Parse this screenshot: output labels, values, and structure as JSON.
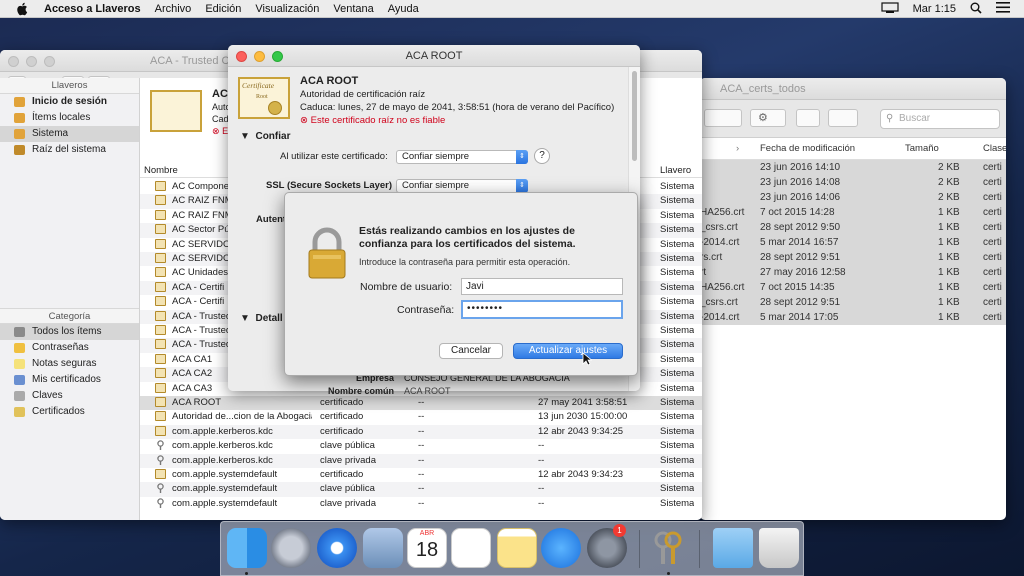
{
  "menubar": {
    "app": "Acceso a Llaveros",
    "items": [
      "Archivo",
      "Edición",
      "Visualización",
      "Ventana",
      "Ayuda"
    ],
    "clock": "Mar 1:15"
  },
  "finder": {
    "title": "ACA_certs_todos",
    "search_placeholder": "Buscar",
    "headers": {
      "date": "Fecha de modificación",
      "size": "Tamaño",
      "kind": "Clase"
    },
    "rows": [
      {
        "name": "",
        "date": "23 jun 2016 14:10",
        "size": "2 KB",
        "kind": "certi"
      },
      {
        "name": "",
        "date": "23 jun 2016 14:08",
        "size": "2 KB",
        "kind": "certi"
      },
      {
        "name": "",
        "date": "23 jun 2016 14:06",
        "size": "2 KB",
        "kind": "certi"
      },
      {
        "name": "HA256.crt",
        "date": "7 oct 2015 14:28",
        "size": "1 KB",
        "kind": "certi"
      },
      {
        "name": "_csrs.crt",
        "date": "28 sept 2012 9:50",
        "size": "1 KB",
        "kind": "certi"
      },
      {
        "name": "-2014.crt",
        "date": "5 mar 2014 16:57",
        "size": "1 KB",
        "kind": "certi"
      },
      {
        "name": "rs.crt",
        "date": "28 sept 2012 9:51",
        "size": "1 KB",
        "kind": "certi"
      },
      {
        "name": "rt",
        "date": "27 may 2016 12:58",
        "size": "1 KB",
        "kind": "certi"
      },
      {
        "name": "HA256.crt",
        "date": "7 oct 2015 14:35",
        "size": "1 KB",
        "kind": "certi"
      },
      {
        "name": "_csrs.crt",
        "date": "28 sept 2012 9:51",
        "size": "1 KB",
        "kind": "certi"
      },
      {
        "name": "-2014.crt",
        "date": "5 mar 2014 17:05",
        "size": "1 KB",
        "kind": "certi"
      }
    ]
  },
  "keychain": {
    "bg_title": "ACA - Trusted Certificates - 2014",
    "sidebar": {
      "keychains_header": "Llaveros",
      "keychains": [
        "Inicio de sesión",
        "Ítems locales",
        "Sistema",
        "Raíz del sistema"
      ],
      "category_header": "Categoría",
      "categories": [
        "Todos los ítems",
        "Contraseñas",
        "Notas seguras",
        "Mis certificados",
        "Claves",
        "Certificados"
      ]
    },
    "preview": {
      "name": "ACA",
      "line1": "Autor",
      "line2": "Caduc",
      "warn": "E"
    },
    "headers": {
      "name": "Nombre",
      "keychain": "Llavero"
    },
    "rows": [
      {
        "name": "AC Componen",
        "kind": "",
        "date": "",
        "exp": "",
        "kc": "Sistema"
      },
      {
        "name": "AC RAIZ FNM",
        "kind": "",
        "date": "",
        "exp": "",
        "kc": "Sistema"
      },
      {
        "name": "AC RAIZ FNM",
        "kind": "",
        "date": "",
        "exp": "",
        "kc": "Sistema"
      },
      {
        "name": "AC Sector Pú",
        "kind": "",
        "date": "",
        "exp": "",
        "kc": "Sistema"
      },
      {
        "name": "AC SERVIDOR",
        "kind": "",
        "date": "",
        "exp": "",
        "kc": "Sistema"
      },
      {
        "name": "AC SERVIDOR",
        "kind": "",
        "date": "",
        "exp": "",
        "kc": "Sistema"
      },
      {
        "name": "AC Unidades.",
        "kind": "",
        "date": "",
        "exp": "",
        "kc": "Sistema"
      },
      {
        "name": "ACA - Certifi",
        "kind": "",
        "date": "",
        "exp": "",
        "kc": "Sistema"
      },
      {
        "name": "ACA - Certifi",
        "kind": "",
        "date": "",
        "exp": "",
        "kc": "Sistema"
      },
      {
        "name": "ACA - Trusted",
        "kind": "",
        "date": "",
        "exp": "",
        "kc": "Sistema"
      },
      {
        "name": "ACA - Trusted",
        "kind": "",
        "date": "",
        "exp": "",
        "kc": "Sistema"
      },
      {
        "name": "ACA - Trusted",
        "kind": "",
        "date": "",
        "exp": "",
        "kc": "Sistema"
      },
      {
        "name": "ACA CA1",
        "kind": "",
        "date": "",
        "exp": "",
        "kc": "Sistema"
      },
      {
        "name": "ACA CA2",
        "kind": "",
        "date": "",
        "exp": "",
        "kc": "Sistema"
      },
      {
        "name": "ACA CA3",
        "kind": "",
        "date": "",
        "exp": "",
        "kc": "Sistema"
      },
      {
        "name": "ACA ROOT",
        "kind": "certificado",
        "date": "--",
        "exp": "27 may 2041 3:58:51",
        "kc": "Sistema"
      },
      {
        "name": "Autoridad de...cion de la Abogacia",
        "kind": "certificado",
        "date": "--",
        "exp": "13 jun 2030 15:00:00",
        "kc": "Sistema"
      },
      {
        "name": "com.apple.kerberos.kdc",
        "kind": "certificado",
        "date": "--",
        "exp": "12 abr 2043 9:34:25",
        "kc": "Sistema"
      },
      {
        "name": "com.apple.kerberos.kdc",
        "kind": "clave pública",
        "date": "--",
        "exp": "--",
        "kc": "Sistema"
      },
      {
        "name": "com.apple.kerberos.kdc",
        "kind": "clave privada",
        "date": "--",
        "exp": "--",
        "kc": "Sistema"
      },
      {
        "name": "com.apple.systemdefault",
        "kind": "certificado",
        "date": "--",
        "exp": "12 abr 2043 9:34:23",
        "kc": "Sistema"
      },
      {
        "name": "com.apple.systemdefault",
        "kind": "clave pública",
        "date": "--",
        "exp": "--",
        "kc": "Sistema"
      },
      {
        "name": "com.apple.systemdefault",
        "kind": "clave privada",
        "date": "--",
        "exp": "--",
        "kc": "Sistema"
      }
    ]
  },
  "acaroot": {
    "title": "ACA ROOT",
    "cert_name": "ACA ROOT",
    "subtitle": "Autoridad de certificación raíz",
    "expiry": "Caduca: lunes, 27 de mayo de 2041, 3:58:51 (hora de verano del Pacífico)",
    "warning": "Este certificado raíz no es fiable",
    "trust_section": "Confiar",
    "when_using_label": "Al utilizar este certificado:",
    "when_using_value": "Confiar siempre",
    "ssl_label": "SSL (Secure Sockets Layer)",
    "ssl_value": "Confiar siempre",
    "auth_partial": "Autent",
    "details_partial": "Detall",
    "empresa_label": "Empresa",
    "empresa_value": "CONSEJO GENERAL DE LA ABOGACIA",
    "cn_label": "Nombre común",
    "cn_value": "ACA ROOT",
    "help": "?",
    "cert_word": "Certificate",
    "root_word": "Root"
  },
  "auth": {
    "heading": "Estás realizando cambios en los ajustes de confianza para los certificados del sistema.",
    "sub": "Introduce la contraseña para permitir esta operación.",
    "user_label": "Nombre de usuario:",
    "user_value": "Javi",
    "pass_label": "Contraseña:",
    "pass_value": "••••••••",
    "cancel": "Cancelar",
    "ok": "Actualizar ajustes"
  },
  "dock": {
    "calendar_month": "ABR",
    "calendar_day": "18",
    "badge": "1"
  },
  "colors": {
    "accent": "#2f7ae4",
    "warning": "#d0021b"
  }
}
